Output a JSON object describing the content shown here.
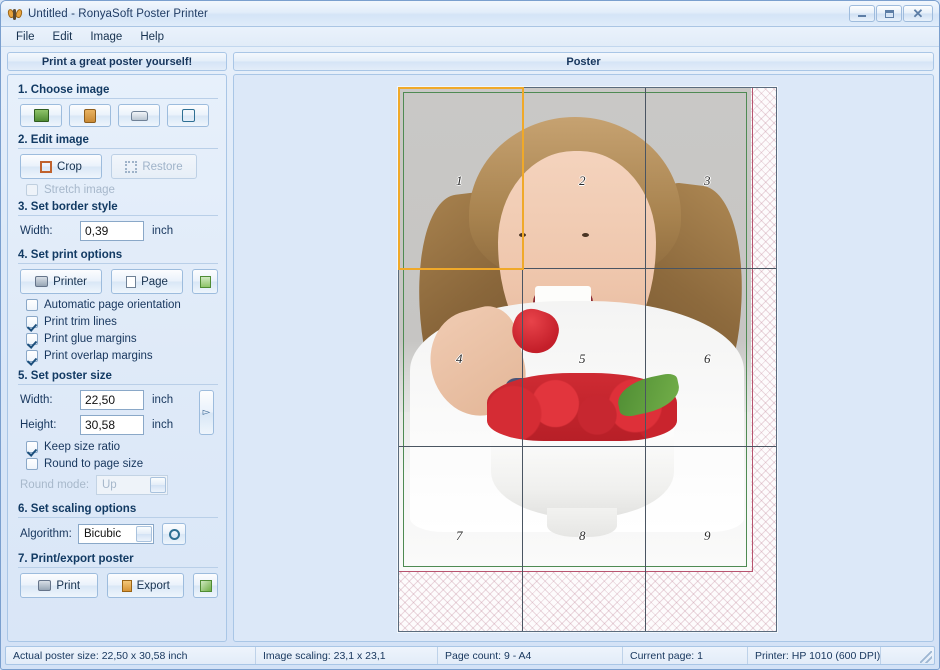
{
  "window": {
    "title": "Untitled - RonyaSoft Poster Printer",
    "app_icon": "butterfly-icon",
    "minimize": "–",
    "maximize": "□",
    "close": "✕"
  },
  "menu": [
    "File",
    "Edit",
    "Image",
    "Help"
  ],
  "headers": {
    "left": "Print a great poster yourself!",
    "right": "Poster"
  },
  "sections": {
    "choose_image": {
      "title": "1. Choose image",
      "buttons": [
        {
          "name": "open-image-icon",
          "label": ""
        },
        {
          "name": "paste-image-icon",
          "label": ""
        },
        {
          "name": "scanner-icon",
          "label": ""
        },
        {
          "name": "external-editor-icon",
          "label": ""
        }
      ]
    },
    "edit_image": {
      "title": "2. Edit image",
      "crop_label": "Crop",
      "restore_label": "Restore",
      "stretch_label": "Stretch image",
      "stretch_checked": false,
      "restore_enabled": false
    },
    "border_style": {
      "title": "3. Set border style",
      "width_label": "Width:",
      "width_value": "0,39",
      "unit": "inch"
    },
    "print_options": {
      "title": "4. Set print options",
      "printer_label": "Printer",
      "page_label": "Page",
      "checkboxes": [
        {
          "label": "Automatic page orientation",
          "checked": false
        },
        {
          "label": "Print trim lines",
          "checked": true
        },
        {
          "label": "Print glue margins",
          "checked": true
        },
        {
          "label": "Print overlap margins",
          "checked": true
        }
      ]
    },
    "poster_size": {
      "title": "5. Set poster size",
      "width_label": "Width:",
      "width_value": "22,50",
      "height_label": "Height:",
      "height_value": "30,58",
      "unit": "inch",
      "keep_ratio_label": "Keep size ratio",
      "keep_ratio_checked": true,
      "round_page_label": "Round to page size",
      "round_page_checked": false,
      "round_mode_label": "Round mode:",
      "round_mode_value": "Up"
    },
    "scaling": {
      "title": "6. Set scaling options",
      "algorithm_label": "Algorithm:",
      "algorithm_value": "Bicubic"
    },
    "print_export": {
      "title": "7. Print/export poster",
      "print_label": "Print",
      "export_label": "Export"
    }
  },
  "poster": {
    "page_numbers": [
      "1",
      "2",
      "3",
      "4",
      "5",
      "6",
      "7",
      "8",
      "9"
    ],
    "selected_page": "1",
    "columns": 3,
    "rows": 3,
    "colors": {
      "selection": "#f0a929",
      "glue_margin": "#4e8a53",
      "trim_line": "#4a5562",
      "overlap_margin": "#b8546f",
      "preview_background": "#dce8f8"
    }
  },
  "statusbar": [
    "Actual poster size: 22,50 x 30,58 inch",
    "Image scaling: 23,1 x 23,1",
    "Page count: 9 - A4",
    "Current page: 1",
    "Printer: HP 1010 (600 DPI)"
  ]
}
